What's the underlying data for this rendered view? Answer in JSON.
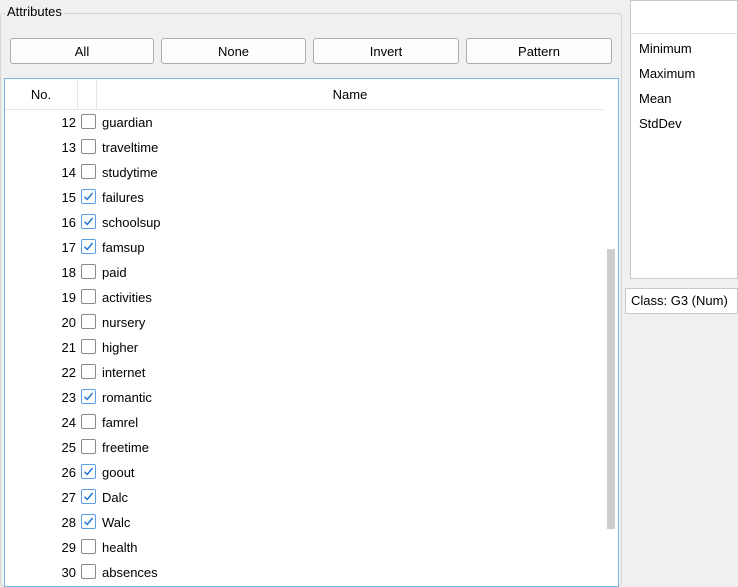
{
  "attributes": {
    "title": "Attributes",
    "buttons": {
      "all": "All",
      "none": "None",
      "invert": "Invert",
      "pattern": "Pattern"
    },
    "table": {
      "col_no": "No.",
      "col_name": "Name",
      "rows": [
        {
          "no": "12",
          "name": "guardian",
          "checked": false
        },
        {
          "no": "13",
          "name": "traveltime",
          "checked": false
        },
        {
          "no": "14",
          "name": "studytime",
          "checked": false
        },
        {
          "no": "15",
          "name": "failures",
          "checked": true
        },
        {
          "no": "16",
          "name": "schoolsup",
          "checked": true
        },
        {
          "no": "17",
          "name": "famsup",
          "checked": true
        },
        {
          "no": "18",
          "name": "paid",
          "checked": false
        },
        {
          "no": "19",
          "name": "activities",
          "checked": false
        },
        {
          "no": "20",
          "name": "nursery",
          "checked": false
        },
        {
          "no": "21",
          "name": "higher",
          "checked": false
        },
        {
          "no": "22",
          "name": "internet",
          "checked": false
        },
        {
          "no": "23",
          "name": "romantic",
          "checked": true
        },
        {
          "no": "24",
          "name": "famrel",
          "checked": false
        },
        {
          "no": "25",
          "name": "freetime",
          "checked": false
        },
        {
          "no": "26",
          "name": "goout",
          "checked": true
        },
        {
          "no": "27",
          "name": "Dalc",
          "checked": true
        },
        {
          "no": "28",
          "name": "Walc",
          "checked": true
        },
        {
          "no": "29",
          "name": "health",
          "checked": false
        },
        {
          "no": "30",
          "name": "absences",
          "checked": false
        }
      ]
    }
  },
  "stats": {
    "labels": [
      "Minimum",
      "Maximum",
      "Mean",
      "StdDev"
    ]
  },
  "class_selector": {
    "value": "Class: G3 (Num)"
  },
  "colors": {
    "accent_border": "#7eb4ea",
    "check": "#1a73d9"
  }
}
